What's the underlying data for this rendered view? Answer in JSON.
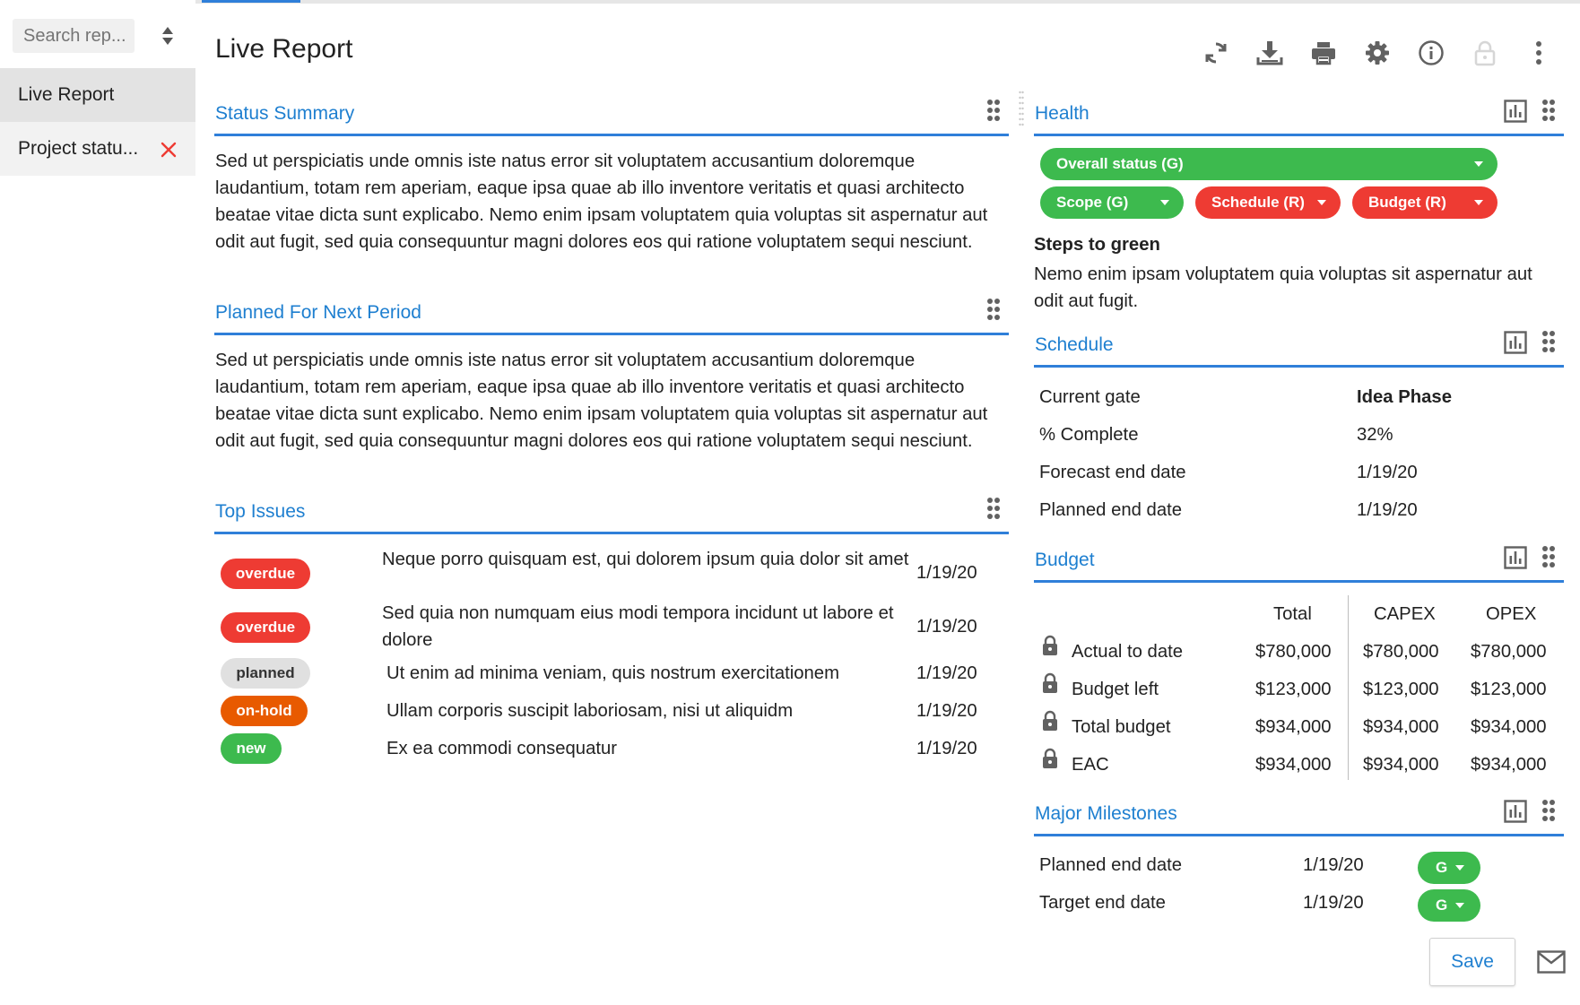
{
  "sidebar": {
    "search_placeholder": "Search rep...",
    "items": [
      {
        "label": "Live Report"
      },
      {
        "label": "Project statu..."
      }
    ]
  },
  "header": {
    "title": "Live Report",
    "toolbar_icons": [
      "refresh-icon",
      "download-icon",
      "print-icon",
      "settings-icon",
      "info-icon",
      "lock-icon",
      "more-vert-icon"
    ]
  },
  "status_summary": {
    "title": "Status Summary",
    "text": "Sed ut perspiciatis unde omnis iste natus error sit voluptatem accusantium doloremque laudantium, totam rem aperiam, eaque ipsa quae ab illo inventore veritatis et quasi architecto beatae vitae dicta sunt explicabo. Nemo enim ipsam voluptatem quia voluptas sit aspernatur aut odit aut fugit, sed quia consequuntur magni dolores eos qui ratione voluptatem sequi nesciunt."
  },
  "planned_next": {
    "title": "Planned For Next Period",
    "text": "Sed ut perspiciatis unde omnis iste natus error sit voluptatem accusantium doloremque laudantium, totam rem aperiam, eaque ipsa quae ab illo inventore veritatis et quasi architecto beatae vitae dicta sunt explicabo. Nemo enim ipsam voluptatem quia voluptas sit aspernatur aut odit aut fugit, sed quia consequuntur magni dolores eos qui ratione voluptatem sequi nesciunt."
  },
  "top_issues": {
    "title": "Top Issues",
    "rows": [
      {
        "status": "overdue",
        "text": "Neque porro quisquam est, qui dolorem ipsum quia dolor sit amet",
        "date": "1/19/20"
      },
      {
        "status": "overdue",
        "text": "Sed quia non numquam eius modi tempora incidunt ut labore et dolore",
        "date": "1/19/20"
      },
      {
        "status": "planned",
        "text": "Ut enim ad minima veniam, quis nostrum exercitationem",
        "date": "1/19/20"
      },
      {
        "status": "on-hold",
        "text": "Ullam corporis suscipit laboriosam, nisi ut aliquidm",
        "date": "1/19/20"
      },
      {
        "status": "new",
        "text": "Ex ea commodi consequatur",
        "date": "1/19/20"
      }
    ]
  },
  "health": {
    "title": "Health",
    "overall": "Overall status (G)",
    "scope": "Scope (G)",
    "schedule": "Schedule (R)",
    "budget": "Budget (R)",
    "steps_title": "Steps to green",
    "steps_text": "Nemo enim ipsam voluptatem quia voluptas sit aspernatur aut odit aut fugit."
  },
  "schedule": {
    "title": "Schedule",
    "rows": [
      {
        "label": "Current gate",
        "value": "Idea Phase"
      },
      {
        "label": "% Complete",
        "value": "32%"
      },
      {
        "label": "Forecast end date",
        "value": "1/19/20"
      },
      {
        "label": "Planned end date",
        "value": "1/19/20"
      }
    ]
  },
  "budget": {
    "title": "Budget",
    "columns": [
      "Total",
      "CAPEX",
      "OPEX"
    ],
    "rows": [
      {
        "label": "Actual to date",
        "total": "$780,000",
        "capex": "$780,000",
        "opex": "$780,000"
      },
      {
        "label": "Budget left",
        "total": "$123,000",
        "capex": "$123,000",
        "opex": "$123,000"
      },
      {
        "label": "Total budget",
        "total": "$934,000",
        "capex": "$934,000",
        "opex": "$934,000"
      },
      {
        "label": "EAC",
        "total": "$934,000",
        "capex": "$934,000",
        "opex": "$934,000"
      }
    ]
  },
  "milestones": {
    "title": "Major Milestones",
    "rows": [
      {
        "label": "Planned end date",
        "date": "1/19/20",
        "status": "G"
      },
      {
        "label": "Target end date",
        "date": "1/19/20",
        "status": "G"
      }
    ]
  },
  "footer": {
    "save_label": "Save"
  },
  "colors": {
    "accent": "#2f7fd9",
    "red": "#ee3b33",
    "green": "#3dba4e",
    "orange": "#e85a00",
    "grey": "#e0e0e0"
  }
}
